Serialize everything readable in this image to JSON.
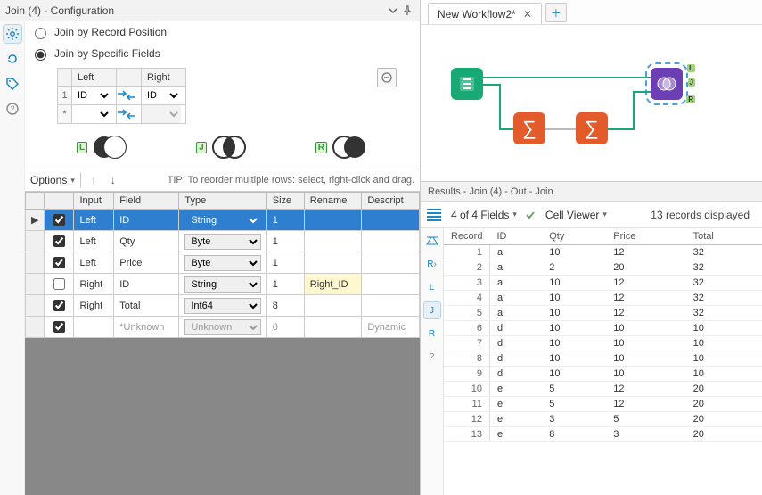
{
  "config": {
    "title": "Join (4) - Configuration",
    "radio_position": "Join by Record Position",
    "radio_fields": "Join by Specific Fields",
    "join_mode_selected": "fields",
    "join_keys": {
      "left_header": "Left",
      "right_header": "Right",
      "rows": [
        {
          "n": "1",
          "left": "ID",
          "right": "ID"
        },
        {
          "n": "*",
          "left": "",
          "right": ""
        }
      ]
    },
    "venn": {
      "L": "L",
      "J": "J",
      "R": "R"
    },
    "options_label": "Options",
    "tip": "TIP: To reorder multiple rows: select, right-click and drag.",
    "columns": {
      "input": "Input",
      "field": "Field",
      "type": "Type",
      "size": "Size",
      "rename": "Rename",
      "descr": "Descript"
    },
    "field_rows": [
      {
        "sel": true,
        "chk": true,
        "input": "Left",
        "field": "ID",
        "type": "String",
        "size": "1",
        "rename": "",
        "descr": "",
        "hl": true
      },
      {
        "sel": false,
        "chk": true,
        "input": "Left",
        "field": "Qty",
        "type": "Byte",
        "size": "1",
        "rename": "",
        "descr": ""
      },
      {
        "sel": false,
        "chk": true,
        "input": "Left",
        "field": "Price",
        "type": "Byte",
        "size": "1",
        "rename": "",
        "descr": ""
      },
      {
        "sel": false,
        "chk": false,
        "input": "Right",
        "field": "ID",
        "type": "String",
        "size": "1",
        "rename": "Right_ID",
        "descr": "",
        "rename_hl": true
      },
      {
        "sel": false,
        "chk": true,
        "input": "Right",
        "field": "Total",
        "type": "Int64",
        "size": "8",
        "rename": "",
        "descr": ""
      },
      {
        "sel": false,
        "chk": true,
        "input": "",
        "field": "*Unknown",
        "type": "Unknown",
        "size": "0",
        "rename": "",
        "descr": "Dynamic",
        "dim": true
      }
    ]
  },
  "workflow": {
    "tab_label": "New Workflow2*"
  },
  "results": {
    "header": "Results - Join (4) - Out - Join",
    "fields_summary": "4 of 4 Fields",
    "cell_viewer": "Cell Viewer",
    "records_summary": "13 records displayed",
    "rail": [
      "∑",
      "R",
      "L",
      "J",
      "R",
      "?"
    ],
    "columns": {
      "record": "Record",
      "id": "ID",
      "qty": "Qty",
      "price": "Price",
      "total": "Total"
    },
    "rows": [
      {
        "n": "1",
        "id": "a",
        "qty": "10",
        "price": "12",
        "total": "32"
      },
      {
        "n": "2",
        "id": "a",
        "qty": "2",
        "price": "20",
        "total": "32"
      },
      {
        "n": "3",
        "id": "a",
        "qty": "10",
        "price": "12",
        "total": "32"
      },
      {
        "n": "4",
        "id": "a",
        "qty": "10",
        "price": "12",
        "total": "32"
      },
      {
        "n": "5",
        "id": "a",
        "qty": "10",
        "price": "12",
        "total": "32"
      },
      {
        "n": "6",
        "id": "d",
        "qty": "10",
        "price": "10",
        "total": "10"
      },
      {
        "n": "7",
        "id": "d",
        "qty": "10",
        "price": "10",
        "total": "10"
      },
      {
        "n": "8",
        "id": "d",
        "qty": "10",
        "price": "10",
        "total": "10"
      },
      {
        "n": "9",
        "id": "d",
        "qty": "10",
        "price": "10",
        "total": "10"
      },
      {
        "n": "10",
        "id": "e",
        "qty": "5",
        "price": "12",
        "total": "20"
      },
      {
        "n": "11",
        "id": "e",
        "qty": "5",
        "price": "12",
        "total": "20"
      },
      {
        "n": "12",
        "id": "e",
        "qty": "3",
        "price": "5",
        "total": "20"
      },
      {
        "n": "13",
        "id": "e",
        "qty": "8",
        "price": "3",
        "total": "20"
      }
    ]
  }
}
